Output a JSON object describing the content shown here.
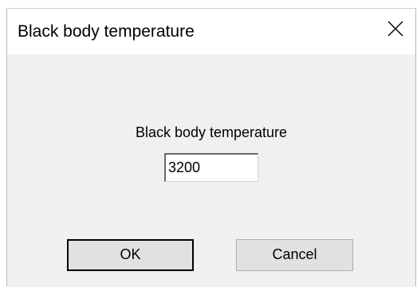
{
  "window": {
    "title": "Black body temperature"
  },
  "close_button": {
    "icon": "close-icon",
    "glyph": "✕"
  },
  "dialog": {
    "prompt_label": "Black body temperature",
    "temperature_value": "3200"
  },
  "buttons": {
    "ok_label": "OK",
    "cancel_label": "Cancel"
  },
  "colors": {
    "titlebar_bg": "#ffffff",
    "client_bg": "#f0f0f0",
    "button_bg": "#e1e1e1",
    "button_border": "#adadad",
    "default_button_border": "#000000"
  }
}
